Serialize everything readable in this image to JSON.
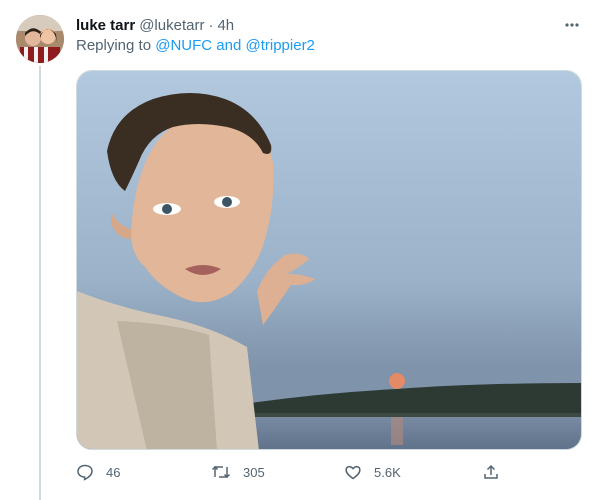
{
  "tweet": {
    "display_name": "luke tarr",
    "handle": "@luketarr",
    "separator": "·",
    "time": "4h",
    "replying_prefix": "Replying to",
    "mention_1": "@NUFC",
    "conjunction": "and",
    "mention_2": "@trippier2"
  },
  "actions": {
    "replies": "46",
    "retweets": "305",
    "likes": "5.6K"
  },
  "colors": {
    "accent": "#1d9bf0",
    "secondary_text": "#536471",
    "border": "#cfd9de"
  },
  "icons": [
    "avatar",
    "more-icon",
    "reply-icon",
    "retweet-icon",
    "like-icon",
    "share-icon"
  ]
}
